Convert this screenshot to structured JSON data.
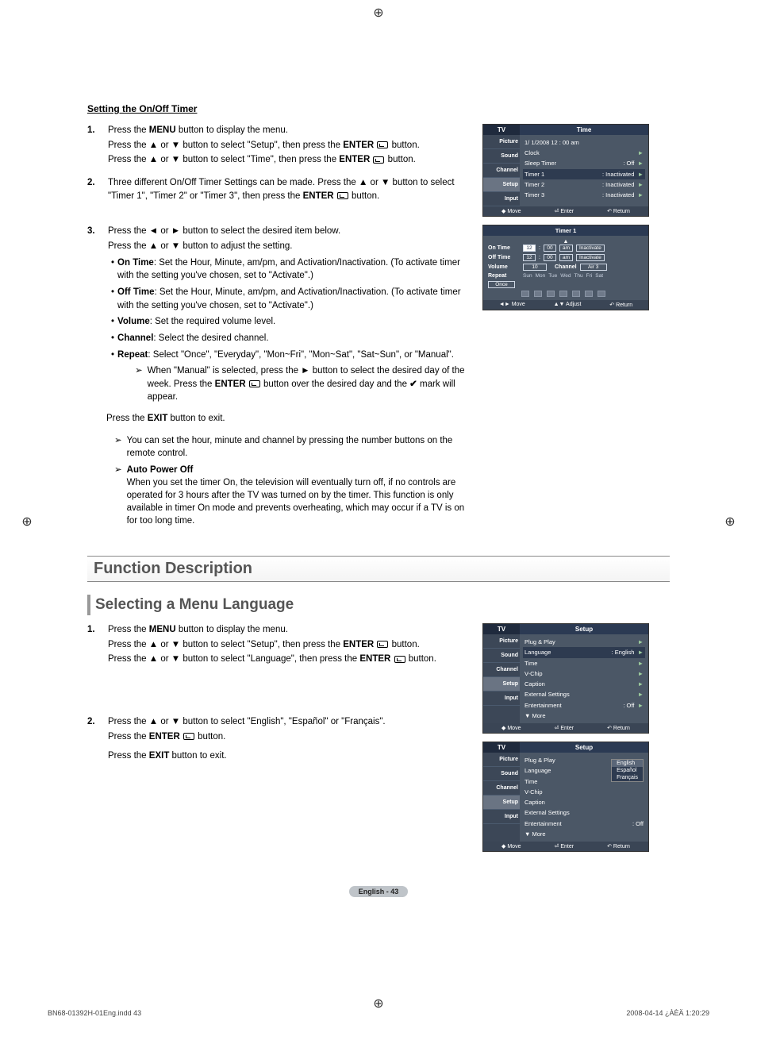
{
  "section_title": "Setting the On/Off Timer",
  "steps": {
    "s1": {
      "num": "1.",
      "l1a": "Press the ",
      "l1b": "MENU",
      "l1c": " button to display the menu.",
      "l2a": "Press the ▲ or ▼ button to select \"Setup\", then press the ",
      "l2b": "ENTER",
      "l2c": " button.",
      "l3a": "Press the ▲ or ▼ button to select \"Time\", then press the ",
      "l3b": "ENTER",
      "l3c": " button."
    },
    "s2": {
      "num": "2.",
      "l1": "Three different On/Off Timer Settings can be made. Press the ▲ or ▼ button to select \"Timer 1\", \"Timer 2\" or \"Timer 3\", then press the ",
      "l1b": "ENTER",
      "l1c": " button."
    },
    "s3": {
      "num": "3.",
      "l1": "Press the ◄ or ► button to select the desired item below.",
      "l2": "Press the ▲ or ▼ button to adjust the setting."
    }
  },
  "bul": {
    "on_time_l": "On Time",
    "on_time_t": ": Set the Hour, Minute, am/pm, and Activation/Inactivation. (To activate timer with the setting you've chosen, set to \"Activate\".)",
    "off_time_l": "Off Time",
    "off_time_t": ": Set the Hour, Minute, am/pm, and Activation/Inactivation. (To activate timer with the setting you've chosen, set to \"Activate\".)",
    "volume_l": "Volume",
    "volume_t": ": Set the required volume level.",
    "channel_l": "Channel",
    "channel_t": ": Select the desired channel.",
    "repeat_l": "Repeat",
    "repeat_t": ": Select \"Once\", \"Everyday\", \"Mon~Fri\", \"Mon~Sat\", \"Sat~Sun\", or \"Manual\".",
    "manual_note_a": "When \"Manual\" is selected, press the ► button to select the desired day of the week. Press the ",
    "manual_note_b": "ENTER",
    "manual_note_c": " button over the desired day and the ",
    "manual_note_d": " mark will appear."
  },
  "post": {
    "exit_a": "Press the ",
    "exit_b": "EXIT",
    "exit_c": " button to exit.",
    "note1": "You can set the hour, minute and channel by pressing the number buttons on the remote control.",
    "apo_l": "Auto Power Off",
    "apo_t": "When you set the timer On, the television will eventually turn off, if no controls are operated for 3 hours after the TV was turned on by the timer. This function is only available in timer On mode and prevents overheating, which may occur if a TV is on for too long time."
  },
  "heading1": "Function Description",
  "heading2": "Selecting a Menu Language",
  "lang_steps": {
    "s1": {
      "num": "1.",
      "l1a": "Press the ",
      "l1b": "MENU",
      "l1c": " button to display the menu.",
      "l2a": "Press the ▲ or ▼ button to select \"Setup\", then press the ",
      "l2b": "ENTER",
      "l2c": " button.",
      "l3a": "Press the ▲ or ▼ button to select \"Language\", then press the ",
      "l3b": "ENTER",
      "l3c": " button."
    },
    "s2": {
      "num": "2.",
      "l1": "Press the ▲ or ▼ button to select \"English\", \"Español\" or \"Français\".",
      "l2a": "Press the ",
      "l2b": "ENTER",
      "l2c": " button.",
      "l3a": "Press the ",
      "l3b": "EXIT",
      "l3c": " button to exit."
    }
  },
  "osd_time": {
    "tv": "TV",
    "title": "Time",
    "tabs": [
      "Picture",
      "Sound",
      "Channel",
      "Setup",
      "Input"
    ],
    "date": "1/  1/2008  12 : 00 am",
    "rows": [
      {
        "l": "Clock",
        "v": ""
      },
      {
        "l": "Sleep Timer",
        "v": ": Off"
      },
      {
        "l": "Timer 1",
        "v": ": Inactivated"
      },
      {
        "l": "Timer 2",
        "v": ": Inactivated"
      },
      {
        "l": "Timer 3",
        "v": ": Inactivated"
      }
    ],
    "footer": [
      "Move",
      "Enter",
      "Return"
    ]
  },
  "osd_timer1": {
    "title": "Timer 1",
    "on_time": "On Time",
    "off_time": "Off Time",
    "hh": "12",
    "mm": "00",
    "ampm": "am",
    "act": "Inactivate",
    "vol_l": "Volume",
    "vol_v": "10",
    "ch_l": "Channel",
    "ch_v": "Air  3",
    "repeat_l": "Repeat",
    "once": "Once",
    "days": [
      "Sun",
      "Mon",
      "Tue",
      "Wed",
      "Thu",
      "Fri",
      "Sat"
    ],
    "footer": [
      "Move",
      "Adjust",
      "Return"
    ]
  },
  "osd_setup": {
    "tv": "TV",
    "title": "Setup",
    "rows": [
      {
        "l": "Plug & Play",
        "v": ""
      },
      {
        "l": "Language",
        "v": ": English"
      },
      {
        "l": "Time",
        "v": ""
      },
      {
        "l": "V-Chip",
        "v": ""
      },
      {
        "l": "Caption",
        "v": ""
      },
      {
        "l": "External Settings",
        "v": ""
      },
      {
        "l": "Entertainment",
        "v": ": Off"
      },
      {
        "l": "▼ More",
        "v": ""
      }
    ],
    "footer": [
      "Move",
      "Enter",
      "Return"
    ]
  },
  "osd_lang": {
    "tv": "TV",
    "title": "Setup",
    "rows": [
      {
        "l": "Plug & Play",
        "v": ""
      },
      {
        "l": "Language",
        "v": ":"
      },
      {
        "l": "Time",
        "v": ""
      },
      {
        "l": "V-Chip",
        "v": ""
      },
      {
        "l": "Caption",
        "v": ""
      },
      {
        "l": "External Settings",
        "v": ""
      },
      {
        "l": "Entertainment",
        "v": ": Off"
      },
      {
        "l": "▼ More",
        "v": ""
      }
    ],
    "options": [
      "English",
      "Español",
      "Français"
    ],
    "footer": [
      "Move",
      "Enter",
      "Return"
    ]
  },
  "page_badge": "English - 43",
  "print_left": "BN68-01392H-01Eng.indd   43",
  "print_right": "2008-04-14   ¿ÀÈÄ 1:20:29"
}
